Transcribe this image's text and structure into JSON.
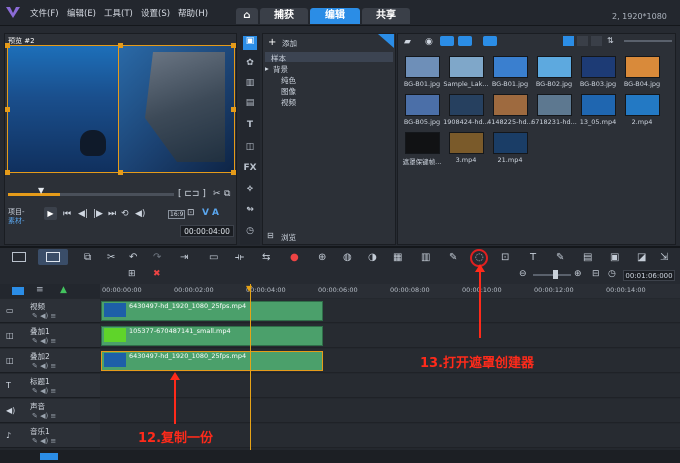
{
  "menu": [
    "文件(F)",
    "编辑(E)",
    "工具(T)",
    "设置(S)",
    "帮助(H)"
  ],
  "tabs": [
    "捕获",
    "编辑",
    "共享"
  ],
  "active_tab": "编辑",
  "resolution": "2, 1920*1080",
  "preview": {
    "label": "预览 #2",
    "project_label": "项目-",
    "clip_label": "素材-",
    "timecode": "00:00:04:00",
    "size_badge": "16:9"
  },
  "library": {
    "add_label": "添加",
    "tree": [
      "样本",
      "背景",
      "纯色",
      "图像",
      "视频"
    ],
    "browse_label": "浏览",
    "thumbs": [
      {
        "label": "BG-B01.jpg",
        "color": "#6e8fb8"
      },
      {
        "label": "Sample_Lak...",
        "color": "#7fa7c9"
      },
      {
        "label": "BG-B01.jpg",
        "color": "#3a7fcf"
      },
      {
        "label": "BG-B02.jpg",
        "color": "#5da9df"
      },
      {
        "label": "BG-B03.jpg",
        "color": "#1d3b75"
      },
      {
        "label": "BG-B04.jpg",
        "color": "#d98a3a"
      },
      {
        "label": "BG-B05.jpg",
        "color": "#4b6fa8"
      },
      {
        "label": "1908424-hd...",
        "color": "#26405f"
      },
      {
        "label": "4148225-hd...",
        "color": "#9e6a3f"
      },
      {
        "label": "6718231-hd...",
        "color": "#5d7890"
      },
      {
        "label": "13_05.mp4",
        "color": "#1f66b0"
      },
      {
        "label": "2.mp4",
        "color": "#2379c4"
      },
      {
        "label": "遮罩保键帧...",
        "color": "#111214"
      },
      {
        "label": "3.mp4",
        "color": "#7a5a2a"
      },
      {
        "label": "21.mp4",
        "color": "#1a3d66"
      }
    ]
  },
  "ruler": [
    "00:00:00:00",
    "00:00:02:00",
    "00:00:04:00",
    "00:00:06:00",
    "00:00:08:00",
    "00:00:10:00",
    "00:00:12:00",
    "00:00:14:00"
  ],
  "toolbar_timecode": "00:01:06:000",
  "tracks": [
    {
      "name": "视频",
      "clip": "6430497-hd_1920_1080_25fps.mp4"
    },
    {
      "name": "叠加1",
      "clip": "105377-670487141_small.mp4"
    },
    {
      "name": "叠加2",
      "clip": "6430497-hd_1920_1080_25fps.mp4"
    },
    {
      "name": "标题1",
      "clip": ""
    },
    {
      "name": "声音",
      "clip": ""
    },
    {
      "name": "音乐1",
      "clip": ""
    }
  ],
  "annotations": {
    "mask_creator": "13.打开遮罩创建器",
    "copy": "12.复制一份"
  },
  "colors": {
    "accent": "#2b8de6",
    "annotation": "#ff2a1a",
    "clip": "#4ba06b",
    "selection": "#e59b1a"
  }
}
